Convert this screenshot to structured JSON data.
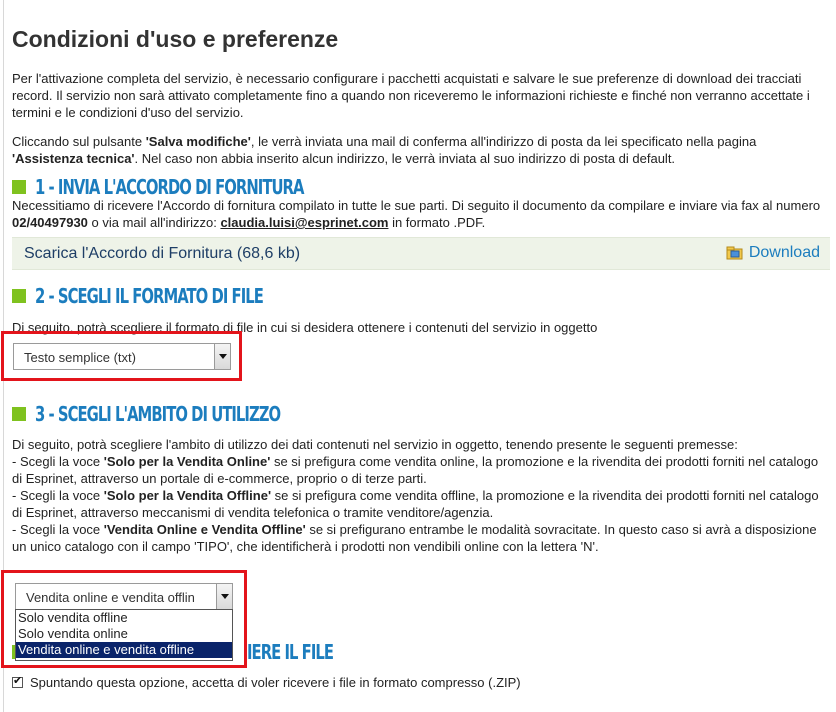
{
  "colors": {
    "heading_blue": "#1c7dbe",
    "bullet_green": "#7fc21f",
    "highlight_red": "#e3141b",
    "selected_option_bg": "#0a246a",
    "download_bar_bg": "#eef3e8"
  },
  "page": {
    "title": "Condizioni d'uso e preferenze",
    "intro": "Per l'attivazione completa del servizio, è necessario configurare i pacchetti acquistati e salvare le sue preferenze di download dei tracciati record. Il servizio non sarà attivato completamente fino a quando non riceveremo le informazioni richieste e finché non verranno accettate i termini e le condizioni d'uso del servizio.",
    "save_note": {
      "part1": "Cliccando sul pulsante ",
      "button_name": "'Salva modifiche'",
      "part2": ", le verrà inviata una mail di conferma all'indirizzo di posta da lei specificato nella pagina ",
      "page_name": "'Assistenza tecnica'",
      "part3": ". Nel caso non abbia inserito alcun indirizzo, le verrà inviata al suo indirizzo di posta di default."
    }
  },
  "section1": {
    "bullet_icon": "green-square-icon",
    "heading": "1 - INVIA L'ACCORDO DI FORNITURA",
    "text_part1": "Necessitiamo di ricevere l'Accordo di fornitura compilato in tutte le sue parti. Di seguito il documento da compilare e inviare via fax al numero ",
    "fax": "02/40497930",
    "text_part2": " o via mail all'indirizzo: ",
    "email": "claudia.luisi@esprinet.com",
    "text_part3": " in formato .PDF.",
    "download_label": "Scarica l'Accordo di Fornitura (68,6 kb)",
    "download_icon": "folder-download-icon",
    "download_link": "Download"
  },
  "section2": {
    "bullet_icon": "green-square-icon",
    "heading": "2 - SCEGLI IL FORMATO DI FILE",
    "text": "Di seguito, potrà scegliere il formato di file in cui si desidera ottenere i contenuti del servizio in oggetto",
    "select_value": "Testo semplice (txt)"
  },
  "section3": {
    "bullet_icon": "green-square-icon",
    "heading": "3 - SCEGLI L'AMBITO DI UTILIZZO",
    "intro": "Di seguito, potrà scegliere l'ambito di utilizzo dei dati contenuti nel servizio in oggetto, tenendo presente le seguenti premesse:",
    "b1_pre": "- Scegli la voce ",
    "b1_key": "'Solo per la Vendita Online'",
    "b1_post": " se si prefigura come vendita online, la promozione e la rivendita dei prodotti forniti nel catalogo di Esprinet, attraverso un portale di e-commerce, proprio o di terze parti.",
    "b2_pre": "- Scegli la voce ",
    "b2_key": "'Solo per la Vendita Offline'",
    "b2_post": " se si prefigura come vendita offline, la promozione e la rivendita dei prodotti forniti nel catalogo di Esprinet, attraverso meccanismi di vendita telefonica o tramite venditore/agenzia.",
    "b3_pre": "- Scegli la voce ",
    "b3_key": "'Vendita Online e Vendita Offline'",
    "b3_post": " se si prefigurano entrambe le modalità sovracitate. In questo caso si avrà a disposizione un unico catalogo con il campo 'TIPO', che identificherà i prodotti non vendibili online con la lettera 'N'.",
    "select_value": "Vendita online e vendita offlin",
    "options": [
      "Solo vendita offline",
      "Solo vendita online",
      "Vendita online e vendita offline"
    ]
  },
  "section4": {
    "bullet_icon": "green-square-icon",
    "heading_visible": "IERE IL FILE",
    "checkbox_checked": true,
    "checkbox_label": "Spuntando questa opzione, accetta di voler ricevere i file in formato compresso (.ZIP)"
  }
}
